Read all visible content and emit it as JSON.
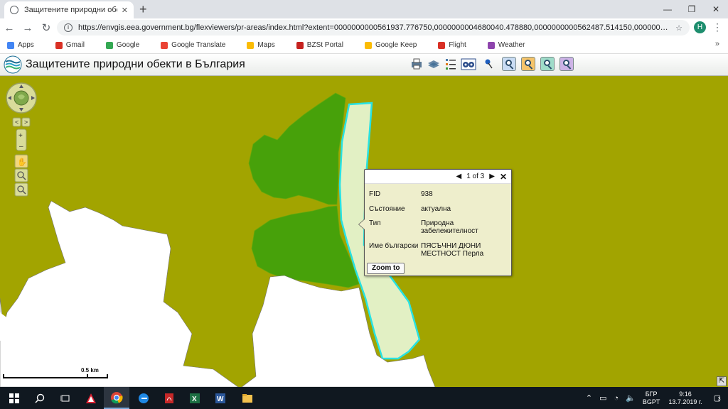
{
  "browser": {
    "tab_title": "Защитените природни обекти",
    "new_tab": "+",
    "window_controls": [
      "—",
      "❐",
      "✕"
    ],
    "url": "https://envgis.eea.government.bg/flexviewers/pr-areas/index.html?extent=0000000000561937.776750,0000000004680040.478880,0000000000562487.514150,000000000468183...",
    "avatar_letter": "H",
    "bookmarks": [
      "Apps",
      "Gmail",
      "Google",
      "Google Translate",
      "Maps",
      "BZSt Portal",
      "Google Keep",
      "Flight",
      "Weather"
    ]
  },
  "app": {
    "title": "Защитените природни обекти в България",
    "tool_icons": [
      "printer-icon",
      "layers-icon",
      "legend-icon",
      "binoculars-icon",
      "pin-icon",
      "search-blue-icon",
      "search-orange-icon",
      "search-teal-icon",
      "search-purple-icon"
    ]
  },
  "popup": {
    "pager": "1 of 3",
    "fields": [
      {
        "label": "FID",
        "value": "938"
      },
      {
        "label": "Състояние",
        "value": "актуална"
      },
      {
        "label": "Тип",
        "value": "Природна забележителност"
      },
      {
        "label": "Име български",
        "value": "ПЯСЪЧНИ ДЮНИ МЕСТНОСТ Перла"
      }
    ],
    "zoom_button": "Zoom to"
  },
  "map": {
    "scale_label": "0.5 km",
    "colors": {
      "background": "#a2a400",
      "green_area": "#47a10a",
      "selected_fill": "#e2f0c4",
      "selected_outline": "#28e2e2",
      "white_area": "#ffffff"
    }
  },
  "taskbar": {
    "lang_top": "БГР",
    "lang_bottom": "BGPT",
    "time": "9:16",
    "date": "13.7.2019 г.",
    "notifications": "3"
  }
}
